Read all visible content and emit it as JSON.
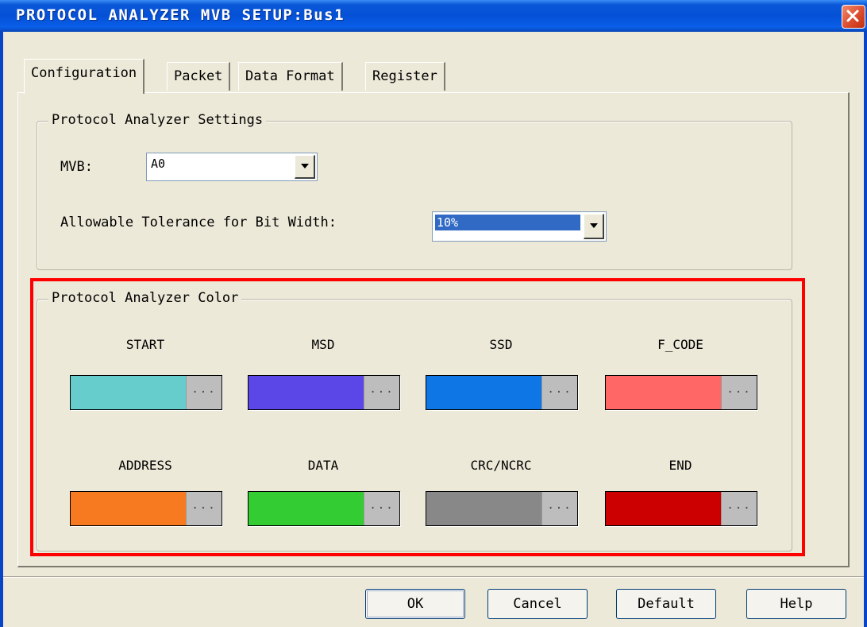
{
  "window": {
    "title": "PROTOCOL ANALYZER MVB SETUP:Bus1"
  },
  "tabs": [
    {
      "label": "Configuration",
      "active": true
    },
    {
      "label": "Packet",
      "active": false
    },
    {
      "label": "Data Format",
      "active": false
    },
    {
      "label": "Register",
      "active": false
    }
  ],
  "settings": {
    "legend": "Protocol Analyzer Settings",
    "mvb_label": "MVB:",
    "mvb_value": "A0",
    "tolerance_label": "Allowable Tolerance for Bit Width:",
    "tolerance_value": "10%"
  },
  "colors": {
    "legend": "Protocol Analyzer Color",
    "button_glyph": "...",
    "items": [
      {
        "label": "START",
        "color": "#66cccc"
      },
      {
        "label": "MSD",
        "color": "#5b47e8"
      },
      {
        "label": "SSD",
        "color": "#0f76e6"
      },
      {
        "label": "F_CODE",
        "color": "#ff6666"
      },
      {
        "label": "ADDRESS",
        "color": "#f87a20"
      },
      {
        "label": "DATA",
        "color": "#33cc33"
      },
      {
        "label": "CRC/NCRC",
        "color": "#888888"
      },
      {
        "label": "END",
        "color": "#cc0000"
      }
    ]
  },
  "buttons": {
    "ok": "OK",
    "cancel": "Cancel",
    "default": "Default",
    "help": "Help"
  },
  "icons": {
    "close": "close-icon",
    "dropdown": "chevron-down-icon"
  }
}
